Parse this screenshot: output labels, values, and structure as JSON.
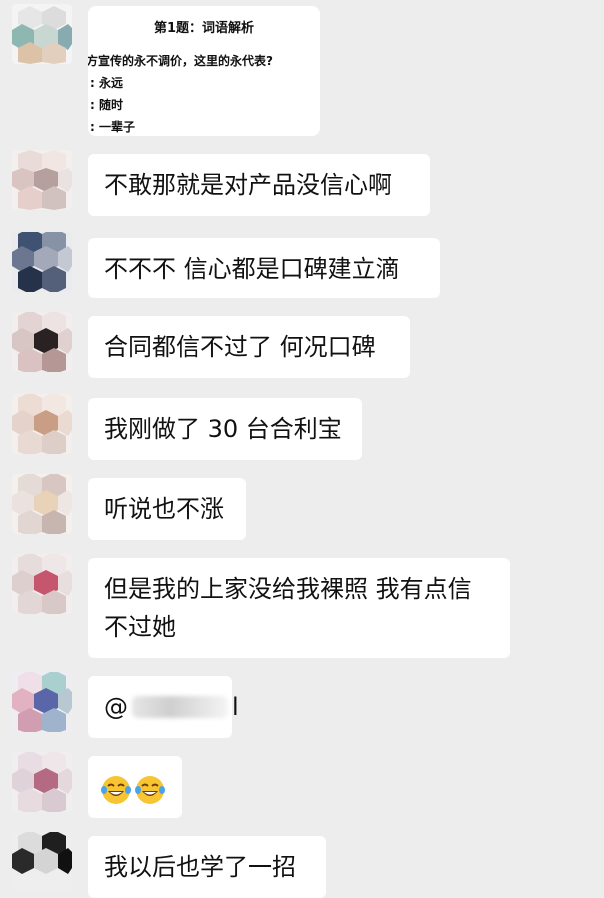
{
  "colors": {
    "background": "#ededed",
    "bubble": "#ffffff",
    "text": "#111111"
  },
  "messages": [
    {
      "type": "image",
      "title": "第1题：词语解析",
      "question": "方宣传的永不调价，这里的永代表?",
      "options": [
        ": 永远",
        ": 随时",
        ": 一辈子"
      ]
    },
    {
      "type": "text",
      "text": "不敢那就是对产品没信心啊"
    },
    {
      "type": "text",
      "text": "不不不  信心都是口碑建立滴"
    },
    {
      "type": "text",
      "text": "合同都信不过了 何况口碑"
    },
    {
      "type": "text",
      "text": "我刚做了 30 台合利宝"
    },
    {
      "type": "text",
      "text": "听说也不涨"
    },
    {
      "type": "text",
      "text": "但是我的上家没给我裸照 我有点信不过她"
    },
    {
      "type": "mention",
      "prefix": "@",
      "suffix": "l"
    },
    {
      "type": "emoji",
      "icons": [
        "tears-of-joy-emoji",
        "tears-of-joy-emoji"
      ]
    },
    {
      "type": "text",
      "text": "我以后也学了一招"
    }
  ]
}
